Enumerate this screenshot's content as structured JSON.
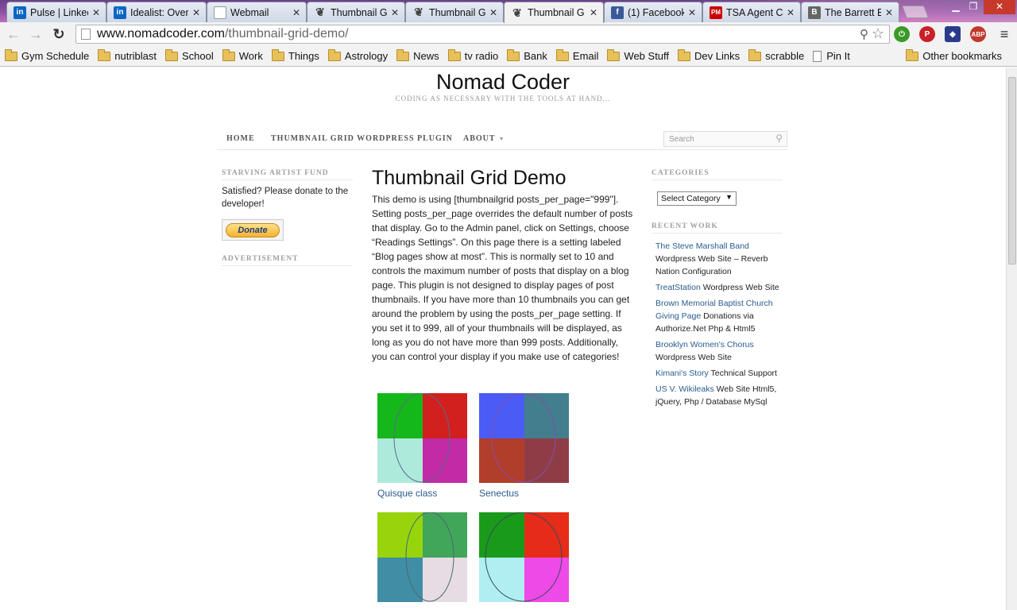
{
  "browser": {
    "tabs": [
      {
        "title": "Pulse | Linkec",
        "icon": "linkedin-icon"
      },
      {
        "title": "Idealist: Over",
        "icon": "linkedin-icon"
      },
      {
        "title": "Webmail",
        "icon": "document-icon"
      },
      {
        "title": "Thumbnail G",
        "icon": "leaf-icon"
      },
      {
        "title": "Thumbnail G",
        "icon": "leaf-icon"
      },
      {
        "title": "Thumbnail G",
        "icon": "leaf-icon"
      },
      {
        "title": "(1) Facebook",
        "icon": "facebook-icon"
      },
      {
        "title": "TSA Agent Cr",
        "icon": "pm-icon"
      },
      {
        "title": "The Barrett B",
        "icon": "barrett-icon"
      }
    ],
    "active_tab": 5,
    "url_host": "www.nomadcoder.com",
    "url_path": "/thumbnail-grid-demo/",
    "bookmarks": [
      "Gym Schedule",
      "nutriblast",
      "School",
      "Work",
      "Things",
      "Astrology",
      "News",
      "tv radio",
      "Bank",
      "Email",
      "Web Stuff",
      "Dev Links",
      "scrabble",
      "Pin It"
    ],
    "other_bookmarks": "Other bookmarks",
    "extensions": {
      "abp_label": "ABP"
    }
  },
  "site": {
    "title": "Nomad Coder",
    "description": "CODING AS NECESSARY WITH THE TOOLS AT HAND...",
    "menu": {
      "home": "HOME",
      "plugin": "THUMBNAIL GRID WORDPRESS PLUGIN",
      "about": "ABOUT"
    },
    "search_placeholder": "Search"
  },
  "left_sidebar": {
    "fund_title": "STARVING ARTIST FUND",
    "fund_text": "Satisfied? Please donate to the developer!",
    "donate_label": "Donate",
    "ad_title": "ADVERTISEMENT"
  },
  "post": {
    "title": "Thumbnail Grid Demo",
    "body": "This demo is using [thumbnailgrid posts_per_page=\"999\"]. Setting posts_per_page overrides the default number of posts that display. Go to the Admin panel, click on Settings, choose “Readings Settings”. On this page there is a setting labeled “Blog pages show at most”. This is normally set to 10 and controls the maximum number of posts that display on a blog page. This plugin is not designed to display pages of post thumbnails. If you have more than 10 thumbnails you can get around the problem by using the posts_per_page setting. If you set it to 999, all of your thumbnails will be displayed, as long as you do not have more than 999 posts. Additionally, you can control your display if you make use of categories!",
    "thumbnails": [
      {
        "caption": "Quisque class",
        "colors": [
          "#15b81a",
          "#d1201e",
          "#aeeadb",
          "#c22aa6"
        ],
        "ellipse": "#5a6a8a"
      },
      {
        "caption": "Senectus",
        "colors": [
          "#4a5cf5",
          "#427e8e",
          "#b13e2a",
          "#8e3d47"
        ],
        "ellipse": "#8a4ab0"
      },
      {
        "caption": "",
        "colors": [
          "#97d40c",
          "#41a65a",
          "#408ea5",
          "#e7dce4"
        ],
        "ellipse": "#4a6a6a"
      },
      {
        "caption": "",
        "colors": [
          "#1a9a1a",
          "#e42c18",
          "#b0eef2",
          "#ee4ae8"
        ],
        "ellipse": "#3a4a5a"
      }
    ]
  },
  "right_sidebar": {
    "categories_title": "CATEGORIES",
    "select_label": "Select Category",
    "recent_title": "RECENT WORK",
    "recent": [
      {
        "link": "The Steve Marshall Band",
        "text": " Wordpress Web Site – Reverb Nation Configuration"
      },
      {
        "link": "TreatStation",
        "text": " Wordpress Web Site"
      },
      {
        "link": "Brown Memorial Baptist Church Giving Page",
        "text": " Donations via Authorize.Net Php & Html5"
      },
      {
        "link": "Brooklyn Women's Chorus",
        "text": " Wordpress Web Site"
      },
      {
        "link": "Kimani's Story",
        "text": " Technical Support"
      },
      {
        "link": "US V. Wikileaks",
        "text": " Web Site Html5, jQuery, Php / Database MySql"
      }
    ]
  }
}
